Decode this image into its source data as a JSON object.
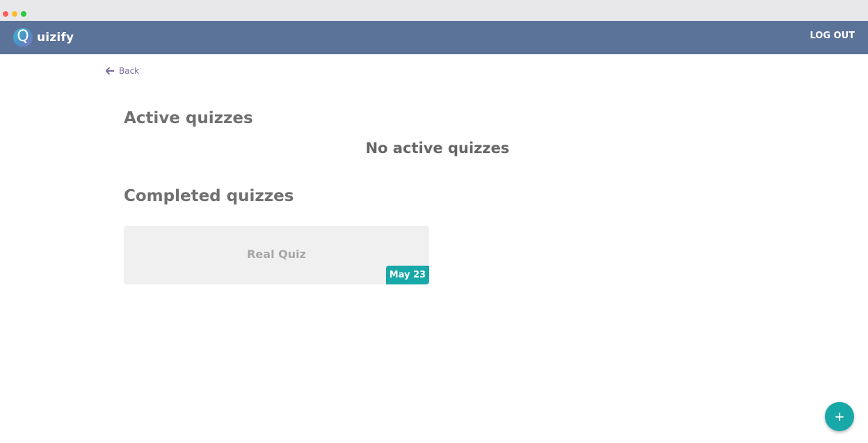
{
  "colors": {
    "navbar": "#5b7399",
    "accent": "#18a8a8",
    "link": "#7a6a9c",
    "window_close": "#fe5f57",
    "window_minimize": "#febc2e",
    "window_maximize": "#28c840"
  },
  "navbar": {
    "brand_letter": "Q",
    "brand_text": "uizify",
    "logout_label": "LOG OUT"
  },
  "back": {
    "icon": "arrow-left-icon",
    "label": "Back"
  },
  "active": {
    "heading": "Active quizzes",
    "empty_message": "No active quizzes"
  },
  "completed": {
    "heading": "Completed quizzes",
    "quizzes": [
      {
        "title": "Real Quiz",
        "date": "May 23"
      }
    ]
  },
  "fab": {
    "icon": "plus-icon",
    "label": "+"
  }
}
